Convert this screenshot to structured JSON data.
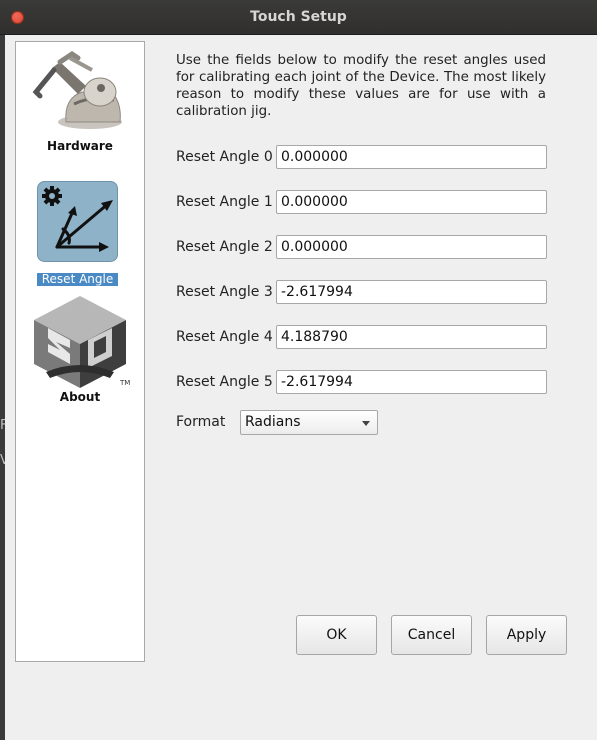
{
  "window": {
    "title": "Touch Setup"
  },
  "sidebar": {
    "items": [
      {
        "label": "Hardware",
        "icon": "haptic-device-icon"
      },
      {
        "label": "Reset Angle",
        "icon": "reset-angle-icon",
        "selected": true
      },
      {
        "label": "About",
        "icon": "3d-systems-logo-icon"
      }
    ],
    "logo_mark": "TM"
  },
  "main": {
    "intro": "Use the fields below to modify the reset angles used for calibrating each joint of the Device. The most likely reason to modify these values are for use with a calibration jig.",
    "angles": [
      {
        "label": "Reset Angle 0",
        "value": "0.000000"
      },
      {
        "label": "Reset Angle 1",
        "value": "0.000000"
      },
      {
        "label": "Reset Angle 2",
        "value": "0.000000"
      },
      {
        "label": "Reset Angle 3",
        "value": "-2.617994"
      },
      {
        "label": "Reset Angle 4",
        "value": "4.188790"
      },
      {
        "label": "Reset Angle 5",
        "value": "-2.617994"
      }
    ],
    "format": {
      "label": "Format",
      "value": "Radians"
    }
  },
  "buttons": {
    "ok": "OK",
    "cancel": "Cancel",
    "apply": "Apply"
  },
  "colors": {
    "selection": "#4a8ac4",
    "close": "#e0463a",
    "icon_bg": "#8eb3c9"
  }
}
